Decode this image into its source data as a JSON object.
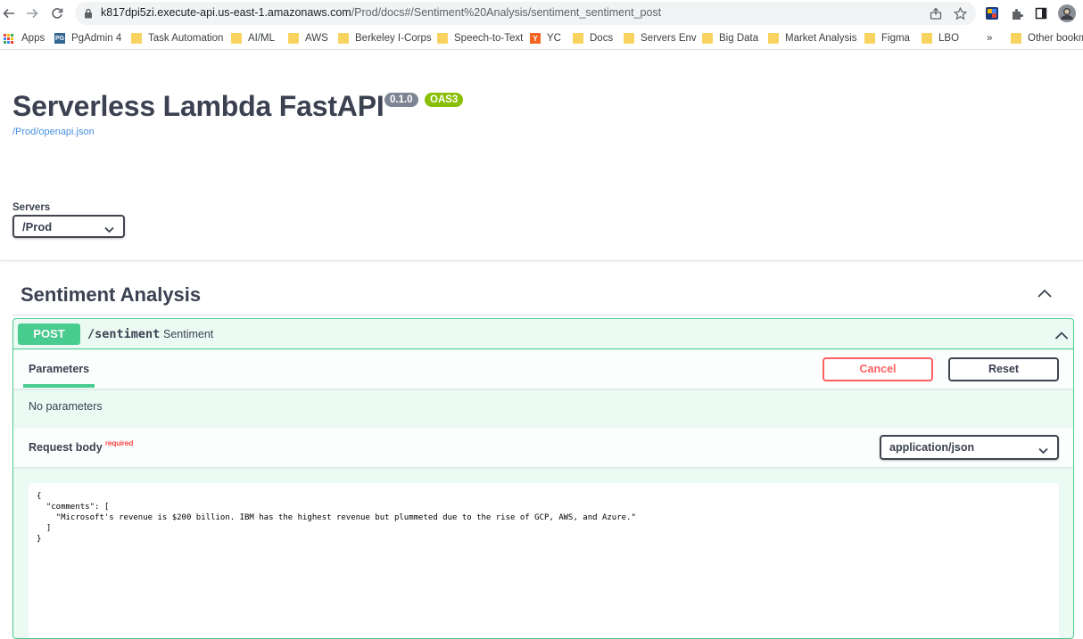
{
  "browser": {
    "url_host": "k817dpi5zi.execute-api.us-east-1.amazonaws.com",
    "url_path": "/Prod/docs#/Sentiment%20Analysis/sentiment_sentiment_post"
  },
  "bookmarks": {
    "items": [
      "Apps",
      "PgAdmin 4",
      "Task Automation",
      "AI/ML",
      "AWS",
      "Berkeley I-Corps",
      "Speech-to-Text",
      "YC",
      "Docs",
      "Servers Env",
      "Big Data",
      "Market Analysis",
      "Figma",
      "LBO"
    ],
    "overflow": "»",
    "other": "Other bookm",
    "pg_icon_text": "PG",
    "yc_icon_text": "Y"
  },
  "api": {
    "title": "Serverless Lambda FastAPI",
    "version": "0.1.0",
    "oas": "OAS3",
    "spec_link": "/Prod/openapi.json"
  },
  "servers": {
    "label": "Servers",
    "selected": "/Prod"
  },
  "tag": {
    "name": "Sentiment Analysis"
  },
  "operation": {
    "method": "POST",
    "path": "/sentiment",
    "summary": "Sentiment",
    "parameters_tab": "Parameters",
    "cancel_label": "Cancel",
    "reset_label": "Reset",
    "no_params": "No parameters",
    "request_body_label": "Request body",
    "required_label": "required",
    "content_type": "application/json",
    "body_lines": [
      "{",
      "  \"comments\": [",
      "    \"Microsoft's revenue is $200 billion. IBM has the highest revenue but plummeted due to the rise of GCP, AWS, and Azure.\"",
      "  ]",
      "}"
    ]
  },
  "colors": {
    "post_green": "#49cc90",
    "cancel_red": "#ff6060",
    "badge_grey": "#7d8492",
    "oas_green": "#89bf04",
    "link_blue": "#4990e2"
  },
  "icons": [
    "back-arrow-icon",
    "forward-arrow-icon",
    "reload-icon",
    "lock-icon",
    "share-icon",
    "star-icon",
    "extension-icon",
    "puzzle-icon",
    "side-panel-icon",
    "profile-avatar",
    "chevron-down-icon",
    "chevron-up-icon",
    "apps-grid-icon",
    "folder-icon"
  ]
}
